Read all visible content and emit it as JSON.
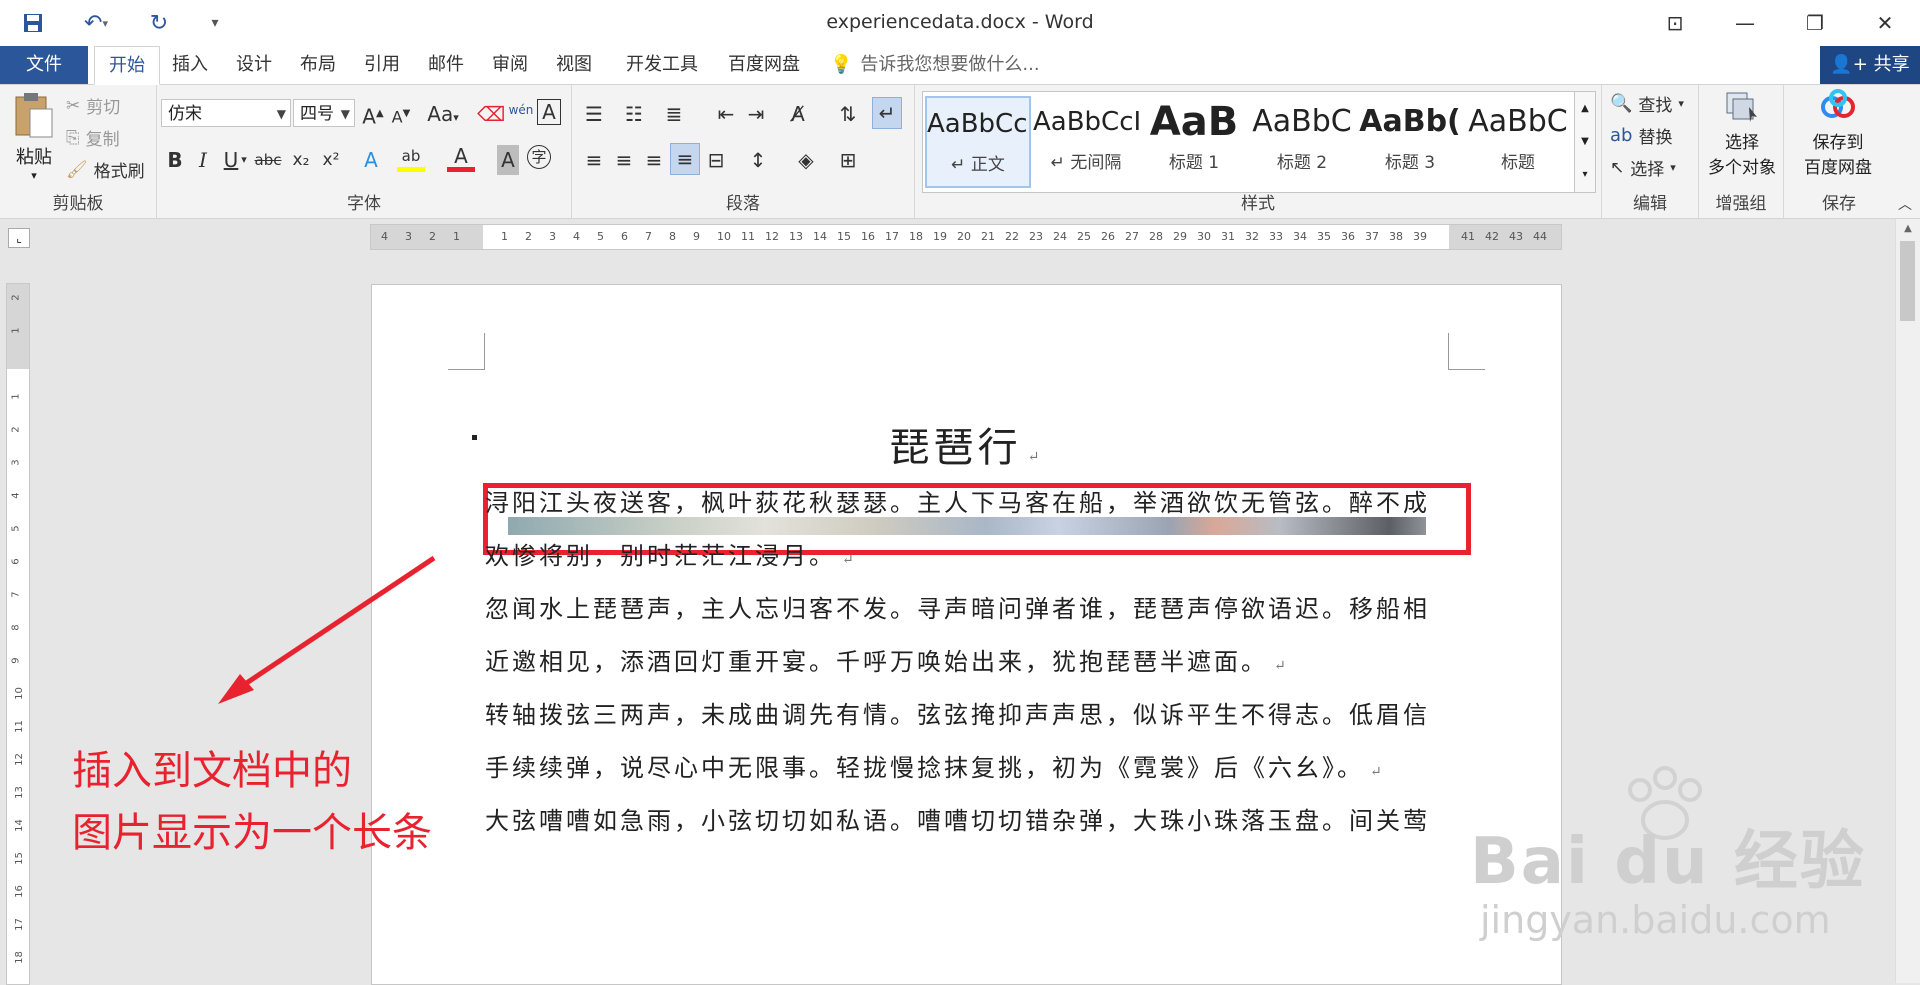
{
  "window": {
    "title": "experiencedata.docx - Word",
    "qat": [
      {
        "name": "save-icon",
        "glyph": "💾"
      },
      {
        "name": "undo-icon",
        "glyph": "↶"
      },
      {
        "name": "redo-icon",
        "glyph": "↻"
      },
      {
        "name": "customize-qat-icon",
        "glyph": "▾"
      }
    ],
    "controls": {
      "ribbon_display": "⊡",
      "minimize": "—",
      "restore": "❐",
      "close": "✕"
    }
  },
  "tabs": {
    "file": "文件",
    "items": [
      "开始",
      "插入",
      "设计",
      "布局",
      "引用",
      "邮件",
      "审阅",
      "视图",
      "开发工具",
      "百度网盘"
    ],
    "active": "开始",
    "tell_me": "告诉我您想要做什么...",
    "share": "共享"
  },
  "ribbon": {
    "clipboard": {
      "label": "剪贴板",
      "paste": "粘贴",
      "cut": "剪切",
      "copy": "复制",
      "format_painter": "格式刷"
    },
    "font": {
      "label": "字体",
      "font_name": "仿宋",
      "font_size": "四号",
      "grow": "A",
      "shrink": "A",
      "change_case": "Aa",
      "phonetic": "wén",
      "bold": "B",
      "italic": "I",
      "underline": "U",
      "strike": "abc",
      "subscript": "x₂",
      "superscript": "x²",
      "text_effects": "A",
      "highlight": "ab",
      "font_color": "A",
      "char_shading": "A",
      "enclose": "字",
      "highlight_color": "#ffff00",
      "font_color_value": "#e8232f"
    },
    "paragraph": {
      "label": "段落"
    },
    "styles": {
      "label": "样式",
      "items": [
        {
          "sample": "AaBbCcI",
          "name": "↵ 正文"
        },
        {
          "sample": "AaBbCcI",
          "name": "↵ 无间隔"
        },
        {
          "sample": "AaB",
          "name": "标题 1"
        },
        {
          "sample": "AaBbC",
          "name": "标题 2"
        },
        {
          "sample": "AaBb(",
          "name": "标题 3"
        },
        {
          "sample": "AaBbC",
          "name": "标题"
        }
      ]
    },
    "editing": {
      "label": "编辑",
      "find": "查找",
      "replace": "替换",
      "select": "选择"
    },
    "enhance": {
      "label": "增强组",
      "line1": "选择",
      "line2": "多个对象"
    },
    "save": {
      "label": "保存",
      "line1": "保存到",
      "line2": "百度网盘"
    }
  },
  "ruler": {
    "numbers": [
      "4",
      "3",
      "2",
      "1",
      "",
      "1",
      "2",
      "3",
      "4",
      "5",
      "6",
      "7",
      "8",
      "9",
      "10",
      "11",
      "12",
      "13",
      "14",
      "15",
      "16",
      "17",
      "18",
      "19",
      "20",
      "21",
      "22",
      "23",
      "24",
      "25",
      "26",
      "27",
      "28",
      "29",
      "30",
      "31",
      "32",
      "33",
      "34",
      "35",
      "36",
      "37",
      "38",
      "39",
      "",
      "41",
      "42",
      "43",
      "44"
    ]
  },
  "vruler_numbers": [
    "2",
    "1",
    "",
    "1",
    "2",
    "3",
    "4",
    "5",
    "6",
    "7",
    "8",
    "9",
    "10",
    "11",
    "12",
    "13",
    "14",
    "15",
    "16",
    "17",
    "18"
  ],
  "document": {
    "title": "琵琶行",
    "paragraphs": [
      "浔阳江头夜送客，枫叶荻花秋瑟瑟。主人下马客在船，举酒欲饮无管弦。醉不成",
      "欢惨将别，别时茫茫江浸月。",
      "忽闻水上琵琶声，主人忘归客不发。寻声暗问弹者谁，琵琶声停欲语迟。移船相",
      "近邀相见，添酒回灯重开宴。千呼万唤始出来，犹抱琵琶半遮面。",
      "转轴拨弦三两声，未成曲调先有情。弦弦掩抑声声思，似诉平生不得志。低眉信",
      "手续续弹，说尽心中无限事。轻拢慢捻抹复挑，初为《霓裳》后《六幺》。",
      "大弦嘈嘈如急雨，小弦切切如私语。嘈嘈切切错杂弹，大珠小珠落玉盘。间关莺"
    ],
    "para_marks": [
      false,
      true,
      false,
      true,
      false,
      true,
      false
    ]
  },
  "annotation": {
    "line1": "插入到文档中的",
    "line2": "图片显示为一个长条",
    "color": "#e8232f"
  },
  "watermark": {
    "main": "Bai du 经验",
    "sub": "jingyan.baidu.com"
  }
}
